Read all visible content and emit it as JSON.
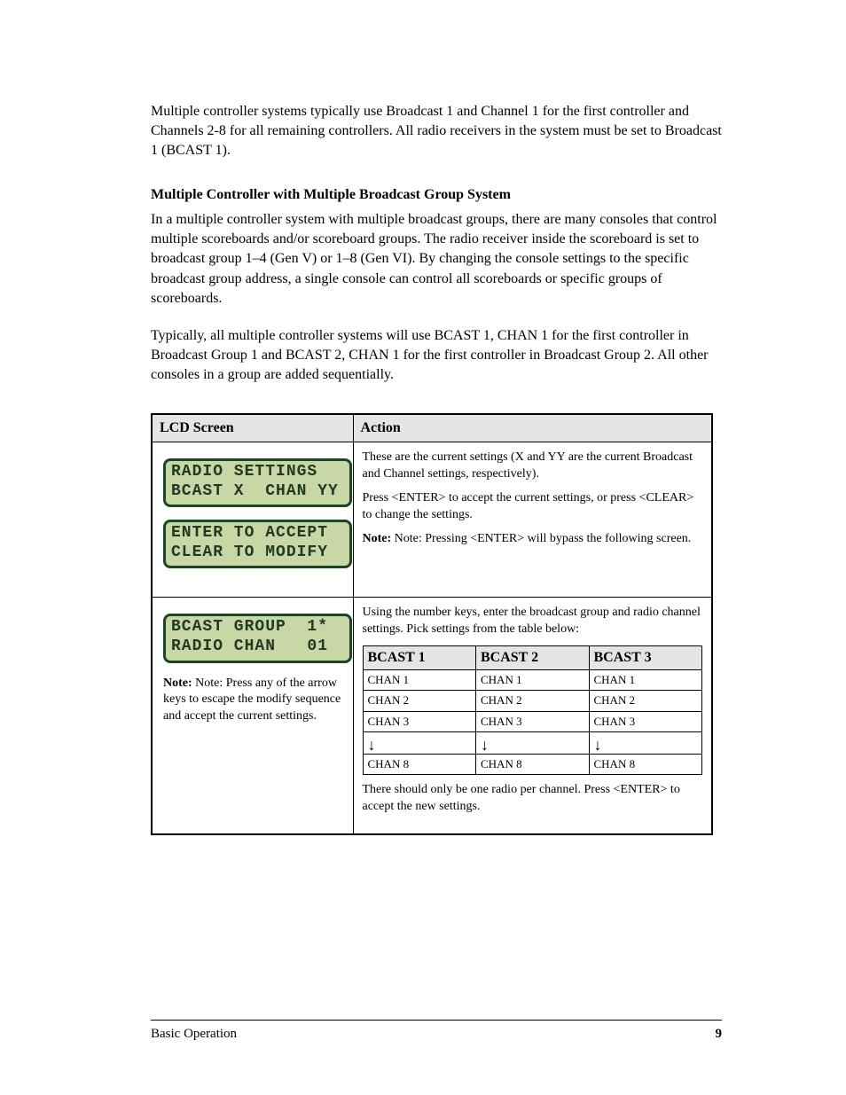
{
  "paragraphs": {
    "p1": "Multiple controller systems typically use Broadcast 1 and Channel 1 for the first controller and Channels 2-8 for all remaining controllers. All radio receivers in the system must be set to Broadcast 1 (BCAST 1).",
    "subhead": "Multiple Controller with Multiple Broadcast Group System",
    "p2": "In a multiple controller system with multiple broadcast groups, there are many consoles that control multiple scoreboards and/or scoreboard groups. The radio receiver inside the scoreboard is set to broadcast group 1–4 (Gen V) or 1–8 (Gen VI). By changing the console settings to the specific broadcast group address, a single console can control all scoreboards or specific groups of scoreboards.",
    "p3": "Typically, all multiple controller systems will use BCAST 1, CHAN 1 for the first controller in Broadcast Group 1 and BCAST 2, CHAN 1 for the first controller in Broadcast Group 2. All other consoles in a group are added sequentially."
  },
  "table": {
    "head_left": "LCD Screen",
    "head_right": "Action",
    "row1": {
      "lcd1_line1": "RADIO SETTINGS",
      "lcd1_line2": "BCAST X  CHAN YY",
      "lcd2_line1": "ENTER TO ACCEPT",
      "lcd2_line2": "CLEAR TO MODIFY",
      "right_1": "These are the current settings (X and YY are the current Broadcast and Channel settings, respectively).",
      "right_2": "Press <ENTER> to accept the current settings, or press <CLEAR> to change the settings.",
      "right_3": "Note: Pressing <ENTER> will bypass the following screen."
    },
    "row2": {
      "lcd_line1": "BCAST GROUP  1*",
      "lcd_line2": "RADIO CHAN   01",
      "note": "Note: Press any of the arrow keys to escape the modify sequence and accept the current settings.",
      "right_intro": "Using the number keys, enter the broadcast group and radio channel settings. Pick settings from the table below:",
      "inner": {
        "headers": [
          "BCAST 1",
          "BCAST 2",
          "BCAST 3"
        ],
        "rows": [
          [
            "CHAN 1",
            "CHAN 1",
            "CHAN 1"
          ],
          [
            "CHAN 2",
            "CHAN 2",
            "CHAN 2"
          ],
          [
            "CHAN 3",
            "CHAN 3",
            "CHAN 3"
          ]
        ],
        "arrow_glyph": "↓",
        "last": [
          "CHAN 8",
          "CHAN 8",
          "CHAN 8"
        ]
      },
      "right_outro": "There should only be one radio per channel. Press <ENTER> to accept the new settings."
    }
  },
  "footer": {
    "left": "Basic Operation",
    "right": "9"
  }
}
